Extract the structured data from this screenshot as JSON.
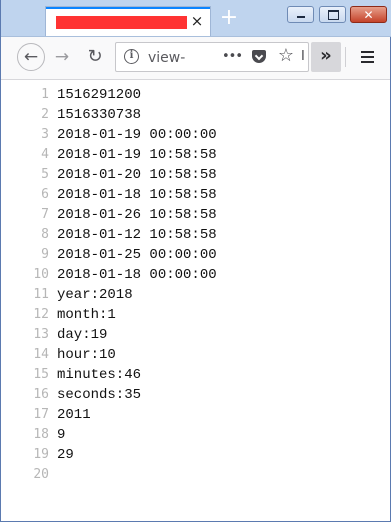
{
  "tab": {
    "close_glyph": "×"
  },
  "toolbar": {
    "back_glyph": "←",
    "forward_glyph": "→",
    "reload_glyph": "↻",
    "url_text": "view-",
    "page_actions": "•••",
    "star_glyph": "☆",
    "url_edge_text": "I",
    "overflow_glyph": "»",
    "new_tab_glyph": "+"
  },
  "window_controls": {
    "close_glyph": "✕"
  },
  "source_lines": [
    {
      "n": "1",
      "text": "1516291200"
    },
    {
      "n": "2",
      "text": "1516330738"
    },
    {
      "n": "3",
      "text": "2018-01-19 00:00:00"
    },
    {
      "n": "4",
      "text": "2018-01-19 10:58:58"
    },
    {
      "n": "5",
      "text": "2018-01-20 10:58:58"
    },
    {
      "n": "6",
      "text": "2018-01-18 10:58:58"
    },
    {
      "n": "7",
      "text": "2018-01-26 10:58:58"
    },
    {
      "n": "8",
      "text": "2018-01-12 10:58:58"
    },
    {
      "n": "9",
      "text": "2018-01-25 00:00:00"
    },
    {
      "n": "10",
      "text": "2018-01-18 00:00:00"
    },
    {
      "n": "11",
      "text": "year:2018"
    },
    {
      "n": "12",
      "text": "month:1"
    },
    {
      "n": "13",
      "text": "day:19"
    },
    {
      "n": "14",
      "text": "hour:10"
    },
    {
      "n": "15",
      "text": "minutes:46"
    },
    {
      "n": "16",
      "text": "seconds:35"
    },
    {
      "n": "17",
      "text": "2011"
    },
    {
      "n": "18",
      "text": "9"
    },
    {
      "n": "19",
      "text": "29"
    },
    {
      "n": "20",
      "text": ""
    }
  ]
}
